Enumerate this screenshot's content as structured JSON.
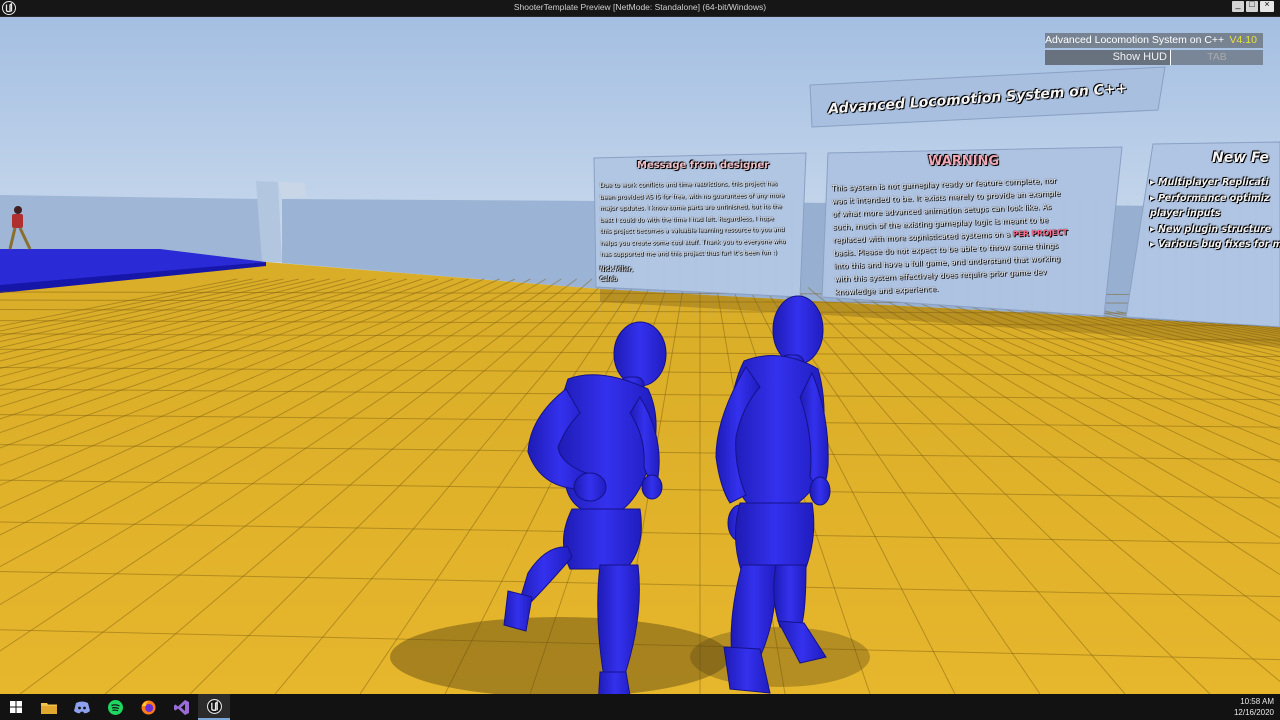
{
  "window": {
    "title": "ShooterTemplate Preview [NetMode: Standalone] (64-bit/Windows)"
  },
  "hud": {
    "project_name": "Advanced Locomotion System on C++",
    "version": "V4.10",
    "show_hud_label": "Show HUD",
    "toggle_key": "TAB"
  },
  "world_signs": {
    "top_banner": "Advanced Locomotion System on C++",
    "message": {
      "title": "Message from designer",
      "lines": [
        "Due to work conflicts and time restrictions, this project has",
        "been provided AS IS for free, with no guarantees of any more",
        "major updates. I know some parts are unfinished, but its the",
        "best I could do with the time I had left. Regardless, I hope",
        "this project becomes a valuable learning resource to you and",
        "helps you create some cool stuff. Thank you to everyone who",
        "has supported me and this project thus far! It's been fun :)"
      ],
      "signature": [
        "Nick Miller,",
        "Caleb"
      ]
    },
    "warning": {
      "title": "WARNING",
      "lines": [
        "This system is not gameplay ready or feature complete, nor",
        "was it intended to be. It exists merely to provide an example",
        "of what more advanced animation setups can look like. As",
        "such, much of the existing gameplay logic is meant to be",
        "replaced with more sophisticated systems on a",
        "basis. Please do not expect to be able to throw some things",
        "into this and have a full game, and understand that working",
        "with this system effectively does require prior game dev",
        "knowledge and experience."
      ],
      "highlight": "PER PROJECT"
    },
    "features": {
      "title": "New Fe",
      "items": [
        "▸ Multiplayer Replicati",
        "▸ Performance optimiz",
        "   player inputs",
        "▸ New plugin structure",
        "▸ Various bug fixes for m"
      ]
    }
  },
  "taskbar": {
    "apps": [
      "windows-start",
      "file-explorer",
      "discord",
      "spotify",
      "firefox",
      "visual-studio",
      "unreal-engine"
    ],
    "time": "10:58 AM",
    "date": "12/16/2020"
  },
  "colors": {
    "sky_top": "#a7c3e6",
    "floor": "#e1b52b",
    "walls": "#9bb3d3",
    "mannequin": "#2a26d6",
    "blue_floor": "#2c2cd8"
  }
}
